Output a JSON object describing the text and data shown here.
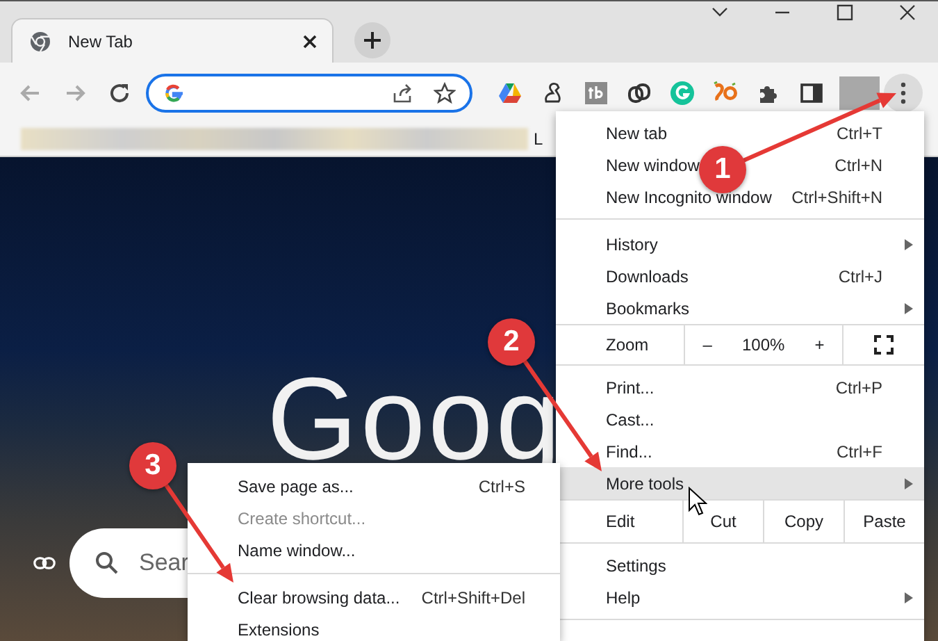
{
  "tab": {
    "title": "New Tab",
    "selected": true
  },
  "bookmarks_bar": {
    "item_text": "L"
  },
  "page": {
    "logo_text": "Goog",
    "search_placeholder": "Sear"
  },
  "menu": {
    "items": [
      {
        "kind": "item",
        "label": "New tab",
        "shortcut": "Ctrl+T",
        "has_submenu": false,
        "highlighted": false
      },
      {
        "kind": "item",
        "label": "New window",
        "shortcut": "Ctrl+N",
        "has_submenu": false,
        "highlighted": false
      },
      {
        "kind": "item",
        "label": "New Incognito window",
        "shortcut": "Ctrl+Shift+N",
        "has_submenu": false,
        "highlighted": false
      },
      {
        "kind": "divider"
      },
      {
        "kind": "item",
        "label": "History",
        "has_submenu": true,
        "highlighted": false
      },
      {
        "kind": "item",
        "label": "Downloads",
        "shortcut": "Ctrl+J",
        "has_submenu": false,
        "highlighted": false
      },
      {
        "kind": "item",
        "label": "Bookmarks",
        "has_submenu": true,
        "highlighted": false
      },
      {
        "kind": "zoom",
        "label": "Zoom",
        "minus": "–",
        "value": "100%",
        "plus": "+"
      },
      {
        "kind": "item",
        "label": "Print...",
        "shortcut": "Ctrl+P",
        "has_submenu": false,
        "highlighted": false
      },
      {
        "kind": "item",
        "label": "Cast...",
        "has_submenu": false,
        "highlighted": false
      },
      {
        "kind": "item",
        "label": "Find...",
        "shortcut": "Ctrl+F",
        "has_submenu": false,
        "highlighted": false
      },
      {
        "kind": "item",
        "label": "More tools",
        "has_submenu": true,
        "highlighted": true
      },
      {
        "kind": "edit",
        "label": "Edit",
        "actions": [
          "Cut",
          "Copy",
          "Paste"
        ]
      },
      {
        "kind": "item",
        "label": "Settings",
        "has_submenu": false,
        "highlighted": false
      },
      {
        "kind": "item",
        "label": "Help",
        "has_submenu": true,
        "highlighted": false
      },
      {
        "kind": "divider"
      }
    ]
  },
  "submenu": {
    "items": [
      {
        "kind": "item",
        "label": "Save page as...",
        "shortcut": "Ctrl+S",
        "disabled": false
      },
      {
        "kind": "item",
        "label": "Create shortcut...",
        "disabled": true
      },
      {
        "kind": "item",
        "label": "Name window...",
        "disabled": false
      },
      {
        "kind": "divider"
      },
      {
        "kind": "item",
        "label": "Clear browsing data...",
        "shortcut": "Ctrl+Shift+Del",
        "disabled": false
      },
      {
        "kind": "item",
        "label": "Extensions",
        "disabled": false
      }
    ]
  },
  "annotations": [
    {
      "number": "1"
    },
    {
      "number": "2"
    },
    {
      "number": "3"
    }
  ]
}
